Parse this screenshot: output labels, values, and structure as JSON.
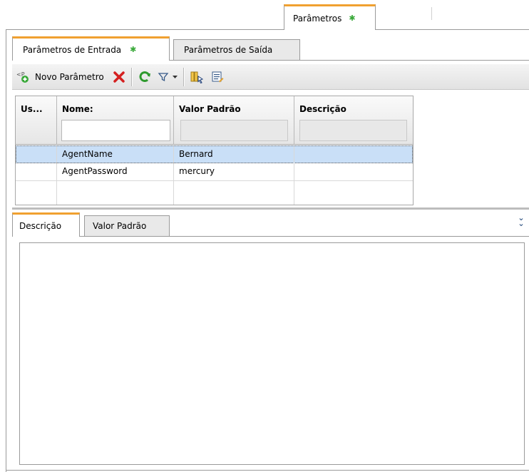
{
  "top_tab": {
    "label": "Parâmetros"
  },
  "tabs": [
    {
      "label": "Parâmetros de Entrada",
      "active": true
    },
    {
      "label": "Parâmetros de Saída",
      "active": false
    }
  ],
  "toolbar": {
    "new_label": "Novo Parâmetro",
    "icons": [
      "new-parameter-icon",
      "delete-icon",
      "refresh-icon",
      "filter-icon",
      "dropdown-icon",
      "select-columns-icon",
      "details-icon"
    ]
  },
  "grid": {
    "columns": [
      "Us...",
      "Nome:",
      "Valor Padrão",
      "Descrição"
    ],
    "rows": [
      {
        "used": "",
        "name": "AgentName",
        "default": "Bernard",
        "description": ""
      },
      {
        "used": "",
        "name": "AgentPassword",
        "default": "mercury",
        "description": ""
      },
      {
        "used": "",
        "name": "",
        "default": "",
        "description": ""
      }
    ],
    "name_filter": ""
  },
  "bottom_tabs": [
    {
      "label": "Descrição",
      "active": true
    },
    {
      "label": "Valor Padrão",
      "active": false
    }
  ],
  "description_text": "",
  "colors": {
    "active_tab_accent": "#f0a030",
    "star": "#3aa93a",
    "selected_row": "#c9dff7",
    "delete_red": "#d42020",
    "refresh_green": "#2f9a2f"
  }
}
